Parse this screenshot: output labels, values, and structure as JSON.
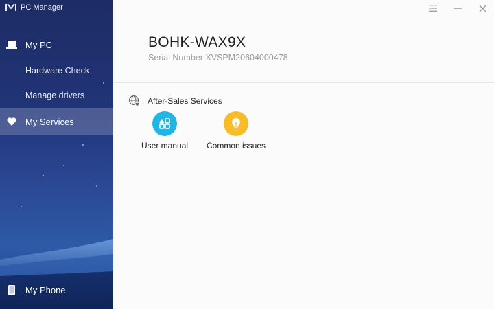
{
  "app": {
    "title": "PC Manager"
  },
  "sidebar": {
    "items": [
      {
        "label": "My PC",
        "icon": "laptop-icon"
      },
      {
        "label": "Hardware Check"
      },
      {
        "label": "Manage drivers"
      },
      {
        "label": "My Services",
        "icon": "heart-icon",
        "active": true
      },
      {
        "label": "My Phone",
        "icon": "phone-icon"
      }
    ]
  },
  "window_controls": [
    "menu-icon",
    "minimize-icon",
    "close-icon"
  ],
  "device": {
    "name": "BOHK-WAX9X",
    "serial_label": "Serial Number:",
    "serial_value": "XVSPM20604000478"
  },
  "services": {
    "section_title": "After-Sales Services",
    "section_icon": "globe-heart-icon",
    "items": [
      {
        "label": "User manual",
        "icon": "grid-manual-icon",
        "color": "#1fb6e6"
      },
      {
        "label": "Common issues",
        "icon": "lightbulb-icon",
        "color": "#f8bc26"
      }
    ]
  }
}
